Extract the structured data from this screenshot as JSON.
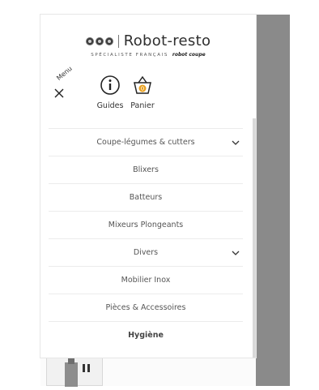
{
  "header": {
    "logo_text": "Robot-resto",
    "logo_tagline": "SPÉCIALISTE FRANÇAIS",
    "logo_brand": "robot coupe",
    "menu_label": "Menu",
    "guides_label": "Guides",
    "cart_label": "Panier",
    "cart_count": "0"
  },
  "menu": {
    "items": [
      {
        "label": "Coupe-légumes & cutters"
      },
      {
        "label": "Blixers"
      },
      {
        "label": "Batteurs"
      },
      {
        "label": "Mixeurs Plongeants"
      },
      {
        "label": "Divers"
      },
      {
        "label": "Mobilier Inox"
      },
      {
        "label": "Pièces & Accessoires"
      },
      {
        "label": "Hygiène"
      }
    ]
  },
  "colors": {
    "overlay": "#8a8a8a",
    "cart_badge": "#e8a020",
    "text": "#555555"
  },
  "icons": [
    "close-icon",
    "info-icon",
    "basket-icon",
    "chevron-down-icon"
  ]
}
